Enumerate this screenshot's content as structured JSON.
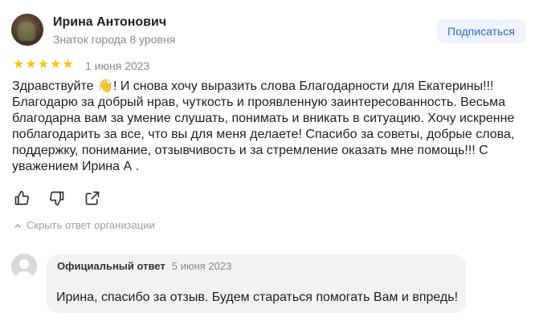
{
  "review": {
    "author_name": "Ирина Антонович",
    "author_level": "Знаток города 8 уровня",
    "subscribe_label": "Подписаться",
    "rating": 5,
    "rating_max": 5,
    "star_color": "#fcc419",
    "date": "1 июня 2023",
    "text": "Здравствуйте 👋! И снова хочу выразить слова Благодарности для Екатерины!!!\nБлагодарю за добрый нрав, чуткость и проявленную заинтересованность. Весьма\nблагодарна вам за умение слушать, понимать и вникать в ситуацию. Хочу искренне\nпоблагодарить за все, что вы для меня делаете! Спасибо за советы, добрые слова,\nподдержку, понимание, отзывчивость и за стремление оказать мне помощь!!! С\nуважением Ирина А ."
  },
  "actions": {
    "like_icon": "thumb-up",
    "dislike_icon": "thumb-down",
    "share_icon": "share"
  },
  "reply_toggle": {
    "label": "Скрыть ответ организации",
    "icon": "chevron-up"
  },
  "official_reply": {
    "title": "Официальный ответ",
    "date": "5 июня 2023",
    "text": "Ирина, спасибо за отзыв. Будем стараться помогать Вам и впредь!"
  },
  "colors": {
    "subscribe_bg": "#eef3fc",
    "subscribe_text": "#2c6bd6",
    "reply_bg": "#f2f2f2"
  }
}
